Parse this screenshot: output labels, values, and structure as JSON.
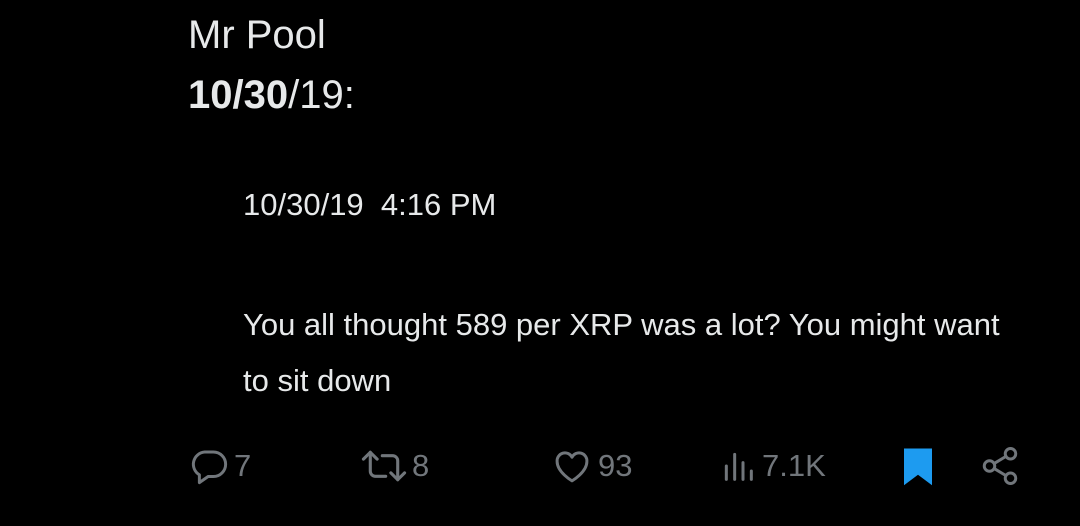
{
  "post": {
    "author": "Mr Pool",
    "date_bold": "10/30",
    "date_rest": "/19:"
  },
  "quoted": {
    "timestamp": "10/30/19  4:16 PM",
    "message": "You all thought 589 per XRP was a lot? You might want to sit down"
  },
  "actions": {
    "replies": "7",
    "retweets": "8",
    "likes": "93",
    "views": "7.1K"
  },
  "colors": {
    "background": "#000000",
    "text": "#e7e9ea",
    "muted": "#71767b",
    "bookmark": "#1d9bf0"
  }
}
